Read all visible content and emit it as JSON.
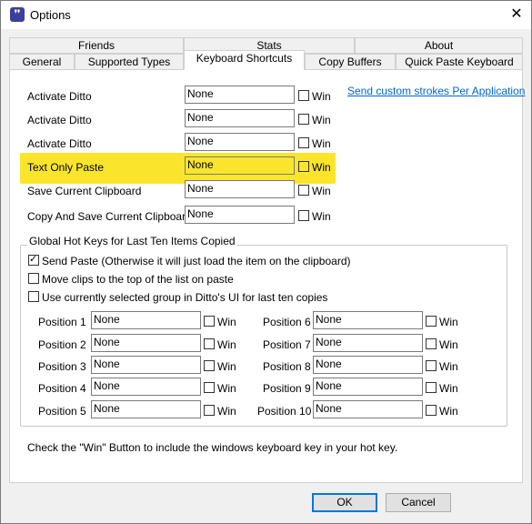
{
  "window": {
    "title": "Options",
    "icon": "ditto-icon",
    "close_label": "✕"
  },
  "tabs_row1": [
    {
      "label": "Friends"
    },
    {
      "label": "Stats"
    },
    {
      "label": "About"
    }
  ],
  "tabs_row2": [
    {
      "label": "General"
    },
    {
      "label": "Supported Types"
    },
    {
      "label": "Keyboard Shortcuts",
      "active": true
    },
    {
      "label": "Copy Buffers"
    },
    {
      "label": "Quick Paste Keyboard"
    }
  ],
  "link": {
    "label": "Send custom strokes Per Application"
  },
  "shortcuts": [
    {
      "label": "Activate Ditto",
      "value": "None",
      "win_label": "Win",
      "win_checked": false
    },
    {
      "label": "Activate Ditto",
      "value": "None",
      "win_label": "Win",
      "win_checked": false
    },
    {
      "label": "Activate Ditto",
      "value": "None",
      "win_label": "Win",
      "win_checked": false
    },
    {
      "label": "Text Only Paste",
      "value": "None",
      "win_label": "Win",
      "win_checked": false,
      "highlighted": true
    },
    {
      "label": "Save Current Clipboard",
      "value": "None",
      "win_label": "Win",
      "win_checked": false
    },
    {
      "label": "Copy And Save Current Clipboard",
      "value": "None",
      "win_label": "Win",
      "win_checked": false
    }
  ],
  "global_group": {
    "title": "Global Hot Keys for Last Ten Items Copied",
    "options": [
      {
        "label": "Send Paste (Otherwise it will just load the item on the clipboard)",
        "checked": true
      },
      {
        "label": "Move clips to the top of the list on paste",
        "checked": false
      },
      {
        "label": "Use currently selected group in Ditto's UI for last ten copies",
        "checked": false
      }
    ],
    "positions_left": [
      {
        "label": "Position 1",
        "value": "None",
        "win_label": "Win"
      },
      {
        "label": "Position 2",
        "value": "None",
        "win_label": "Win"
      },
      {
        "label": "Position 3",
        "value": "None",
        "win_label": "Win"
      },
      {
        "label": "Position 4",
        "value": "None",
        "win_label": "Win"
      },
      {
        "label": "Position 5",
        "value": "None",
        "win_label": "Win"
      }
    ],
    "positions_right": [
      {
        "label": "Position 6",
        "value": "None",
        "win_label": "Win"
      },
      {
        "label": "Position 7",
        "value": "None",
        "win_label": "Win"
      },
      {
        "label": "Position 8",
        "value": "None",
        "win_label": "Win"
      },
      {
        "label": "Position 9",
        "value": "None",
        "win_label": "Win"
      },
      {
        "label": "Position 10",
        "value": "None",
        "win_label": "Win"
      }
    ]
  },
  "footer_note": "Check the \"Win\" Button to include the windows keyboard key in your hot key.",
  "buttons": {
    "ok_label": "OK",
    "cancel_label": "Cancel"
  },
  "colors": {
    "highlight": "#fbe52c",
    "link": "#0066cc",
    "default_button_border": "#0078d7"
  }
}
